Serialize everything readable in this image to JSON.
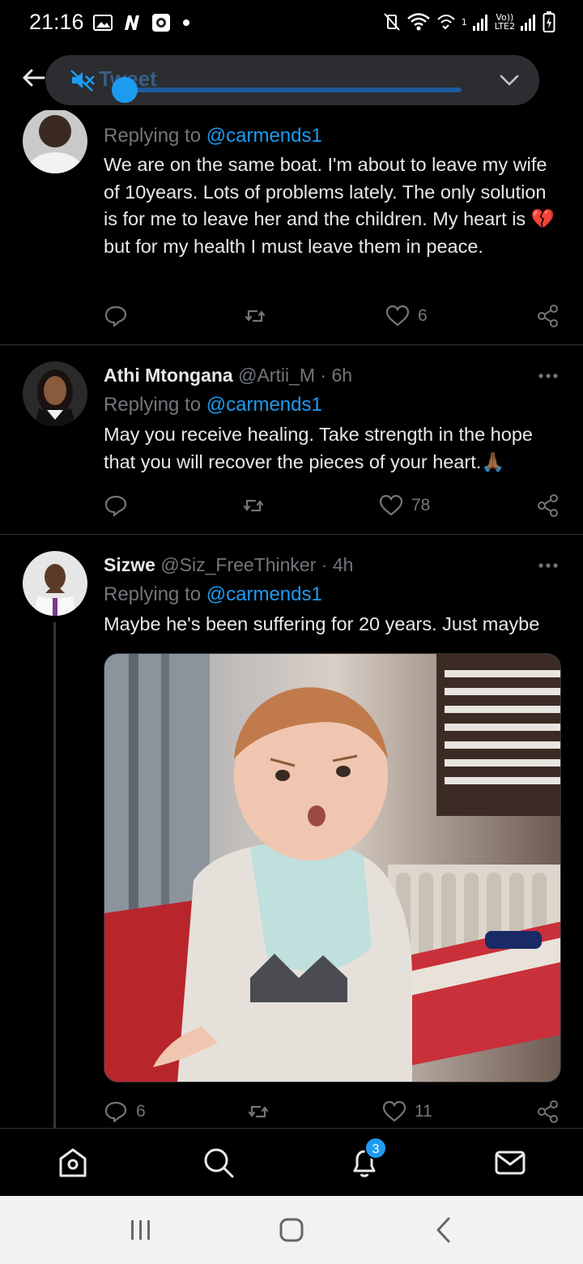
{
  "status_bar": {
    "time": "21:16",
    "network_label_top": "Vo))",
    "network_label_bottom": "LTE2",
    "sim_label": "1"
  },
  "header": {
    "title": "Tweet"
  },
  "tweets": [
    {
      "reply_prefix": "Replying to",
      "reply_to": "@carmends1",
      "text_before_emoji": "We are on the same boat. I'm about to leave my wife of 10years. Lots of problems lately. The only solution is for me to leave her and the children. My heart is ",
      "emoji": "💔",
      "text_after_emoji": " but for my health I must leave them in peace.",
      "replies": "",
      "retweets": "",
      "likes": "6"
    },
    {
      "name": "Athi Mtongana",
      "handle_time": "@Artii_M · 6h",
      "reply_prefix": "Replying to",
      "reply_to": "@carmends1",
      "text": "May you receive healing. Take strength in the hope that you will recover the pieces of your heart.",
      "emoji": "🙏🏾",
      "likes": "78"
    },
    {
      "name": "Sizwe",
      "handle_time": "@Siz_FreeThinker · 4h",
      "reply_prefix": "Replying to",
      "reply_to": "@carmends1",
      "text": "Maybe he's been suffering for 20 years. Just maybe",
      "replies": "6",
      "likes": "11"
    }
  ],
  "bottom_nav": {
    "notifications_badge": "3"
  },
  "colors": {
    "accent": "#1d9bf0",
    "background": "#000000",
    "muted_text": "#71767b",
    "divider": "#2f3336"
  }
}
